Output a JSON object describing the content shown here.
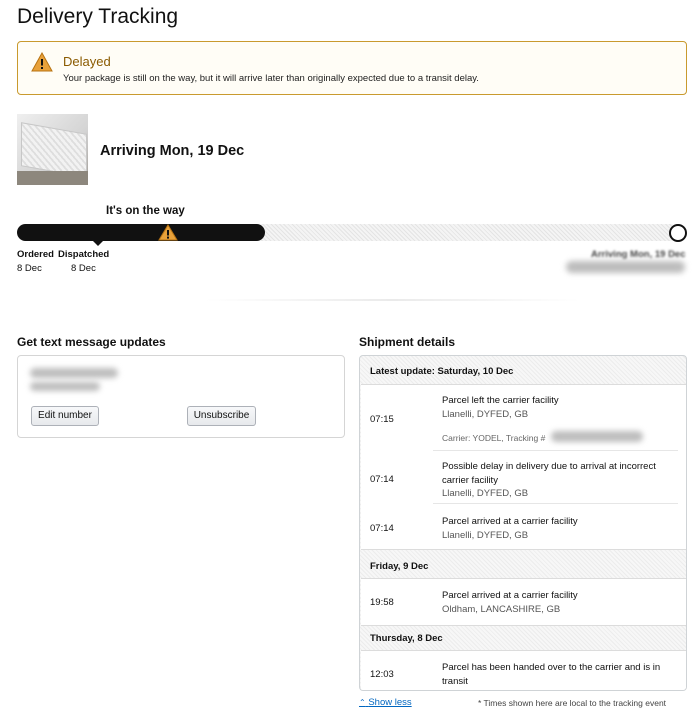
{
  "page": {
    "title": "Delivery Tracking"
  },
  "alert": {
    "title": "Delayed",
    "message": "Your package is still on the way, but it will arrive later than originally expected due to a transit delay.",
    "color": "#c99a2e"
  },
  "product": {
    "arriving": "Arriving Mon, 19 Dec",
    "image_icon": "mattress-image"
  },
  "progress": {
    "status": "It's on the way",
    "fill_fraction": 0.375,
    "steps": [
      {
        "label": "Ordered",
        "date": "8 Dec"
      },
      {
        "label": "Dispatched",
        "date": "8 Dec"
      },
      {
        "label": "Arriving Mon, 19 Dec",
        "date": ""
      }
    ]
  },
  "sms": {
    "title": "Get text message updates",
    "edit_label": "Edit number",
    "unsubscribe_label": "Unsubscribe"
  },
  "shipment": {
    "title": "Shipment details",
    "groups": [
      {
        "day": "Latest update: Saturday, 10 Dec",
        "events": [
          {
            "time": "07:15",
            "text": "Parcel left the carrier facility",
            "location": "Llanelli, DYFED, GB",
            "carrier": "Carrier: YODEL, Tracking #"
          },
          {
            "time": "07:14",
            "text": "Possible delay in delivery due to arrival at incorrect carrier facility",
            "location": "Llanelli, DYFED, GB"
          },
          {
            "time": "07:14",
            "text": "Parcel arrived at a carrier facility",
            "location": "Llanelli, DYFED, GB"
          }
        ]
      },
      {
        "day": "Friday, 9 Dec",
        "events": [
          {
            "time": "19:58",
            "text": "Parcel arrived at a carrier facility",
            "location": "Oldham, LANCASHIRE, GB"
          }
        ]
      },
      {
        "day": "Thursday, 8 Dec",
        "events": [
          {
            "time": "12:03",
            "text": "Parcel has been handed over to the carrier and is in transit",
            "location": ""
          }
        ]
      }
    ]
  },
  "footer": {
    "show_less": "Show less",
    "footnote": "* Times shown here are local to the tracking event"
  }
}
